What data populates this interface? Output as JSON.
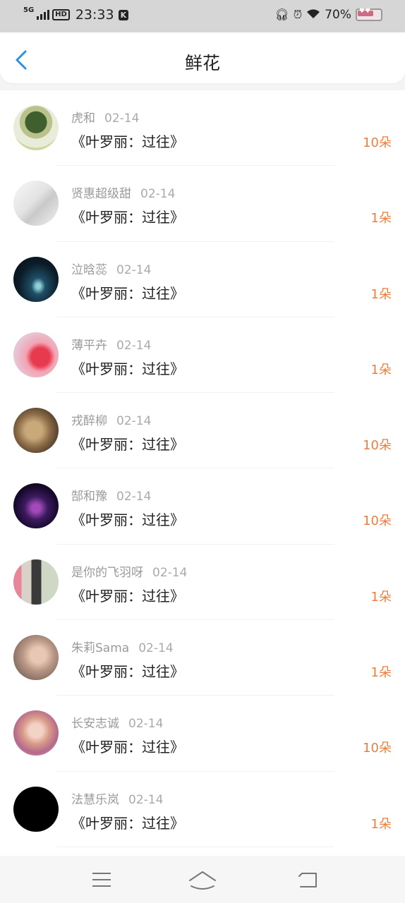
{
  "status_bar": {
    "network": "5G",
    "hd": "HD",
    "time": "23:33",
    "k_badge": "K",
    "battery": "70%",
    "icons": [
      "headphones-icon",
      "alarm-icon",
      "wifi-icon"
    ]
  },
  "header": {
    "title": "鲜花",
    "back_icon": "chevron-left-icon"
  },
  "colors": {
    "accent_blue": "#2f8fe3",
    "count_orange": "#ef7d3b"
  },
  "rows": [
    {
      "user": "虎和",
      "date": "02-14",
      "work": "《叶罗丽：过往》",
      "count": "10朵"
    },
    {
      "user": "贤惠超级甜",
      "date": "02-14",
      "work": "《叶罗丽：过往》",
      "count": "1朵"
    },
    {
      "user": "泣晗蕊",
      "date": "02-14",
      "work": "《叶罗丽：过往》",
      "count": "1朵"
    },
    {
      "user": "薄平卉",
      "date": "02-14",
      "work": "《叶罗丽：过往》",
      "count": "1朵"
    },
    {
      "user": "戎醉柳",
      "date": "02-14",
      "work": "《叶罗丽：过往》",
      "count": "10朵"
    },
    {
      "user": "郜和豫",
      "date": "02-14",
      "work": "《叶罗丽：过往》",
      "count": "10朵"
    },
    {
      "user": "是你的飞羽呀",
      "date": "02-14",
      "work": "《叶罗丽：过往》",
      "count": "1朵"
    },
    {
      "user": "朱莉Sama",
      "date": "02-14",
      "work": "《叶罗丽：过往》",
      "count": "1朵"
    },
    {
      "user": "长安志诚",
      "date": "02-14",
      "work": "《叶罗丽：过往》",
      "count": "10朵"
    },
    {
      "user": "法慧乐岚",
      "date": "02-14",
      "work": "《叶罗丽：过往》",
      "count": "1朵"
    }
  ],
  "nav": {
    "icons": [
      "menu-icon",
      "home-icon",
      "back-icon"
    ]
  }
}
